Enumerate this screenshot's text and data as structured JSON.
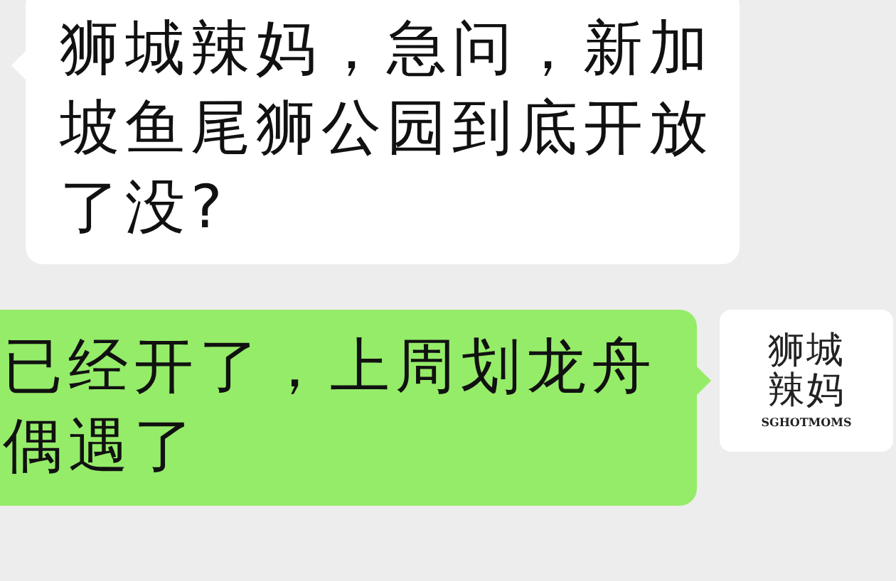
{
  "messages": [
    {
      "kind": "incoming",
      "text": "狮城辣妈，急问，新加坡鱼尾狮公园到底开放了没?"
    },
    {
      "kind": "outgoing",
      "text": "已经开了，上周划龙舟偶遇了",
      "avatar": {
        "lines": [
          "狮城",
          "辣妈"
        ],
        "caption": "SGHOTMOMS"
      }
    }
  ]
}
